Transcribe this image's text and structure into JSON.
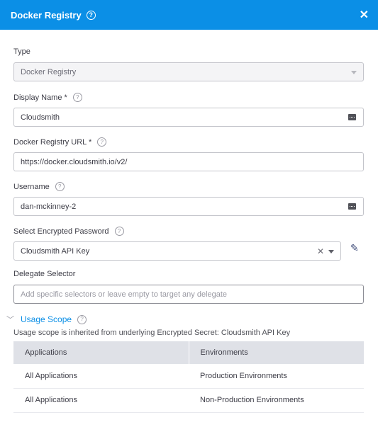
{
  "dialog": {
    "title": "Docker Registry",
    "help_glyph": "?",
    "close_glyph": "✕"
  },
  "form": {
    "type": {
      "label": "Type",
      "value": "Docker Registry"
    },
    "display_name": {
      "label": "Display Name *",
      "value": "Cloudsmith"
    },
    "registry_url": {
      "label": "Docker Registry URL *",
      "value": "https://docker.cloudsmith.io/v2/"
    },
    "username": {
      "label": "Username",
      "value": "dan-mckinney-2"
    },
    "password": {
      "label": "Select Encrypted Password",
      "value": "Cloudsmith API Key",
      "clear_glyph": "✕",
      "edit_glyph": "✎"
    },
    "delegate": {
      "label": "Delegate Selector",
      "placeholder": "Add specific selectors or leave empty to target any delegate"
    }
  },
  "usage_scope": {
    "title": "Usage Scope",
    "chevron_glyph": "﹀",
    "note": "Usage scope is inherited from underlying Encrypted Secret: Cloudsmith API Key",
    "columns": [
      "Applications",
      "Environments"
    ],
    "rows": [
      [
        "All Applications",
        "Production Environments"
      ],
      [
        "All Applications",
        "Non-Production Environments"
      ]
    ]
  },
  "colors": {
    "header": "#0b8fe6",
    "link": "#0b8fe6",
    "table_header": "#dfe1e7"
  },
  "icons": [
    "help-icon",
    "close-icon",
    "chevron-down-icon",
    "key-icon",
    "clear-icon",
    "pencil-icon"
  ]
}
